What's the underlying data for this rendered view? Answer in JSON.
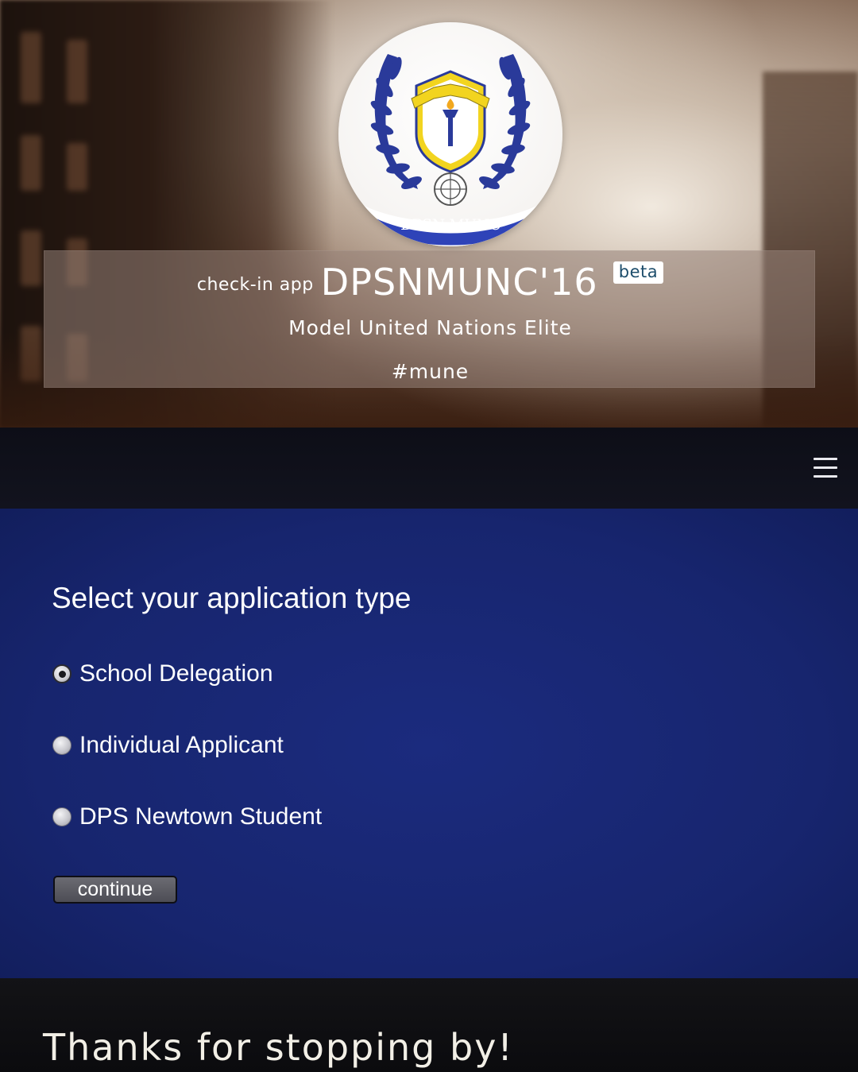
{
  "header": {
    "logo_caption": "DPSN MUNC",
    "title_prefix": "check-in app",
    "title_main": "DPSNMUNC'16",
    "badge": "beta",
    "subtitle": "Model United Nations Elite",
    "hashtag": "#mune"
  },
  "navbar": {
    "menu_icon": "hamburger-menu-icon"
  },
  "form": {
    "heading": "Select your application type",
    "options": [
      {
        "label": "School Delegation",
        "checked": true
      },
      {
        "label": "Individual Applicant",
        "checked": false
      },
      {
        "label": "DPS Newtown Student",
        "checked": false
      }
    ],
    "continue_label": "continue"
  },
  "footer": {
    "text": "Thanks for stopping by!"
  },
  "colors": {
    "form_background": "#17256e",
    "navbar_background": "#0d0e17",
    "badge_text": "#1d4d6b",
    "logo_blue": "#2a3a9a",
    "logo_yellow": "#f2d41f"
  }
}
